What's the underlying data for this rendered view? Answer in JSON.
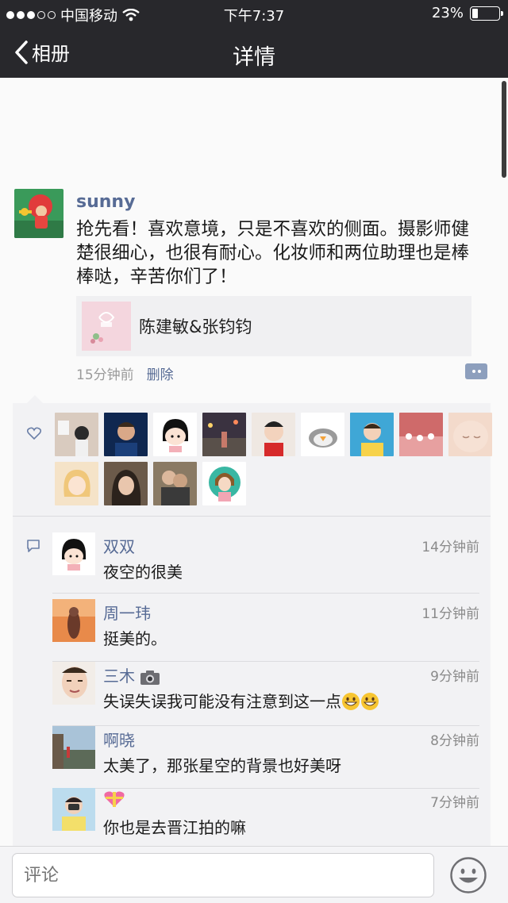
{
  "status_bar": {
    "carrier": "中国移动",
    "time": "下午7:37",
    "battery": "23%",
    "battery_level": 0.23
  },
  "nav": {
    "back_label": "相册",
    "title": "详情"
  },
  "post": {
    "author": "sunny",
    "text": "抢先看！喜欢意境，只是不喜欢的侧面。摄影师健楚很细心，也很有耐心。化妆师和两位助理也是棒棒哒，辛苦你们了！",
    "link_title": "陈建敏&张钧钧",
    "time": "15分钟前",
    "delete_label": "删除"
  },
  "likes": {
    "count": 14
  },
  "comments": [
    {
      "name": "双双",
      "time": "14分钟前",
      "text": "夜空的很美"
    },
    {
      "name": "周一玮",
      "time": "11分钟前",
      "text": "挺美的。"
    },
    {
      "name": "三木",
      "time": "9分钟前",
      "text": "失误失误我可能没有注意到这一点"
    },
    {
      "name": "啊晓",
      "time": "8分钟前",
      "text": "太美了，那张星空的背景也好美呀"
    },
    {
      "name": "",
      "time": "7分钟前",
      "text": "你也是去晋江拍的嘛"
    }
  ],
  "comment_input": {
    "placeholder": "评论"
  },
  "colors": {
    "nav_bg": "#28282c",
    "link_blue": "#576b95",
    "comment_bg": "#f2f2f4"
  }
}
